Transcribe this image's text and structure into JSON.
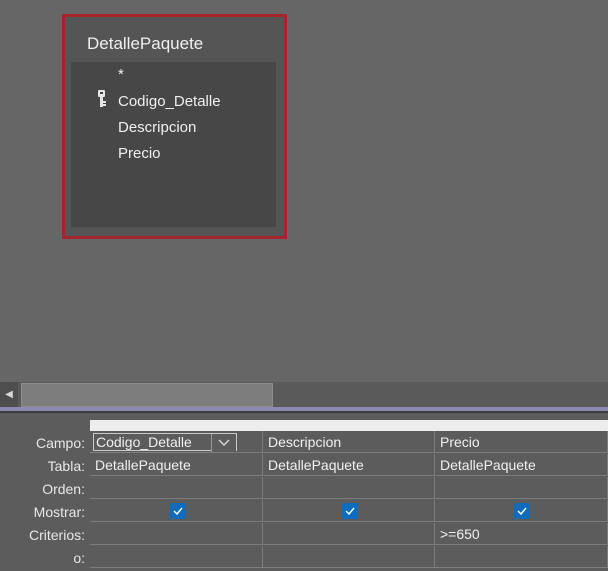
{
  "table": {
    "title": "DetallePaquete",
    "fields": [
      "*",
      "Codigo_Detalle",
      "Descripcion",
      "Precio"
    ]
  },
  "grid": {
    "row_labels": [
      "Campo:",
      "Tabla:",
      "Orden:",
      "Mostrar:",
      "Criterios:",
      "o:"
    ],
    "columns": [
      {
        "campo": "Codigo_Detalle",
        "tabla": "DetallePaquete",
        "orden": "",
        "mostrar": true,
        "criterios": "",
        "o": ""
      },
      {
        "campo": "Descripcion",
        "tabla": "DetallePaquete",
        "orden": "",
        "mostrar": true,
        "criterios": "",
        "o": ""
      },
      {
        "campo": "Precio",
        "tabla": "DetallePaquete",
        "orden": "",
        "mostrar": true,
        "criterios": ">=650",
        "o": ""
      }
    ]
  },
  "colors": {
    "table_border": "#a4262c",
    "checkbox": "#0f6cbd",
    "background": "#666666"
  },
  "icons": {
    "primary_key": "key-icon",
    "scroll_left": "triangle-left-icon",
    "dropdown": "chevron-down-icon",
    "check": "checkmark-icon"
  }
}
